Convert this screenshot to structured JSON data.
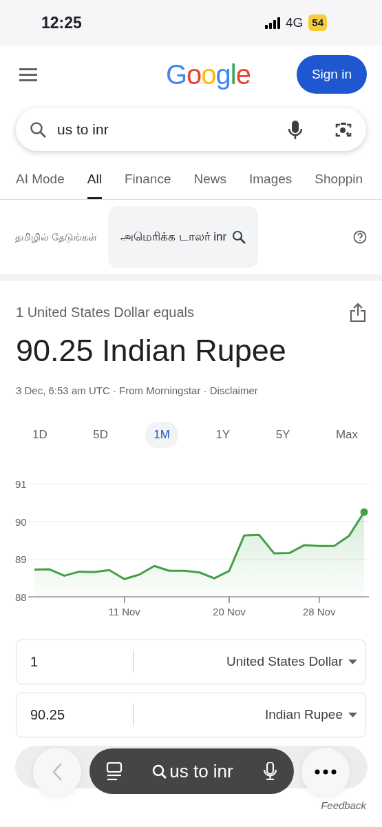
{
  "status_bar": {
    "time": "12:25",
    "network": "4G",
    "battery": "54"
  },
  "header": {
    "logo": "Google",
    "sign_in": "Sign in"
  },
  "search": {
    "value": "us to inr"
  },
  "tabs": [
    {
      "label": "AI Mode",
      "selected": false
    },
    {
      "label": "All",
      "selected": true
    },
    {
      "label": "Finance",
      "selected": false
    },
    {
      "label": "News",
      "selected": false
    },
    {
      "label": "Images",
      "selected": false
    },
    {
      "label": "Shoppin",
      "selected": false
    }
  ],
  "language_suggestion": {
    "label": "தமிழில் தேடுங்கள்",
    "query": "அமெரிக்க டாலர் inr"
  },
  "converter": {
    "heading": "1 United States Dollar equals",
    "result": "90.25 Indian Rupee",
    "meta": "3 Dec, 6:53 am UTC · From Morningstar · Disclaimer",
    "ranges": [
      {
        "label": "1D",
        "selected": false
      },
      {
        "label": "5D",
        "selected": false
      },
      {
        "label": "1M",
        "selected": true
      },
      {
        "label": "1Y",
        "selected": false
      },
      {
        "label": "5Y",
        "selected": false
      },
      {
        "label": "Max",
        "selected": false
      }
    ],
    "chart_data": {
      "type": "area",
      "categories": [
        null,
        null,
        null,
        null,
        null,
        null,
        "11 Nov",
        null,
        null,
        null,
        null,
        null,
        null,
        "20 Nov",
        null,
        null,
        null,
        null,
        null,
        "28 Nov",
        null,
        null,
        null
      ],
      "series": [
        {
          "color": "#43a047",
          "values": [
            88.72,
            88.73,
            88.56,
            88.67,
            88.66,
            88.71,
            88.47,
            88.59,
            88.82,
            88.69,
            88.69,
            88.65,
            88.49,
            88.69,
            89.63,
            89.64,
            89.15,
            89.16,
            89.37,
            89.35,
            89.35,
            89.62,
            90.25
          ]
        }
      ],
      "ylim": [
        88,
        91
      ],
      "yticks": [
        88,
        89,
        90,
        91
      ]
    },
    "rows": [
      {
        "amount": "1",
        "currency": "United States Dollar"
      },
      {
        "amount": "90.25",
        "currency": "Indian Rupee"
      }
    ]
  },
  "bottom_bar": {
    "query": "us to inr",
    "feedback": "Feedback"
  }
}
